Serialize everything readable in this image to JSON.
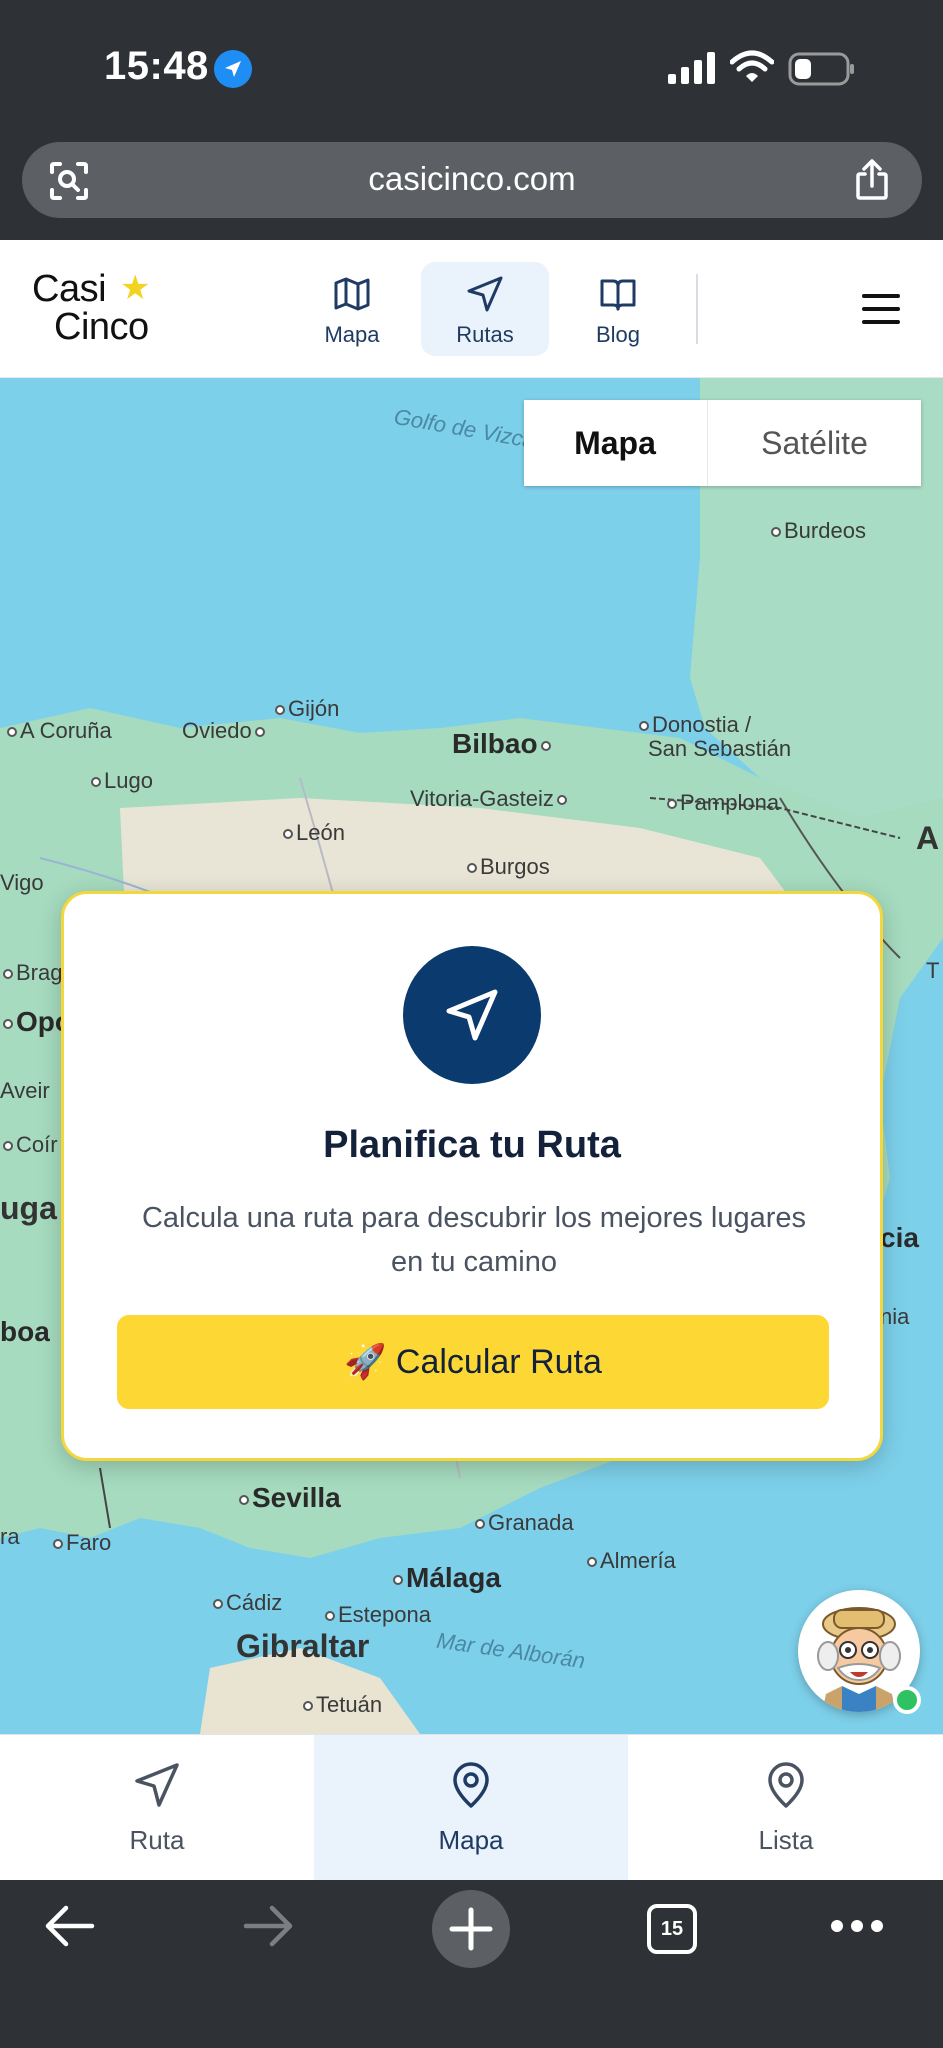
{
  "status_bar": {
    "time": "15:48"
  },
  "browser": {
    "url": "casicinco.com",
    "open_tabs": "15"
  },
  "site_header": {
    "logo_line1": "Casi",
    "logo_line2": "Cinco",
    "nav": [
      {
        "label": "Mapa",
        "icon": "map-icon"
      },
      {
        "label": "Rutas",
        "icon": "navigation-arrow-icon",
        "active": true
      },
      {
        "label": "Blog",
        "icon": "book-icon"
      }
    ]
  },
  "map": {
    "map_type": {
      "map": "Mapa",
      "satellite": "Satélite",
      "selected": "Mapa"
    },
    "labels": {
      "golfo": "Golfo de Vizcaya",
      "burdeos": "Burdeos",
      "acoruna": "A Coruña",
      "oviedo": "Oviedo",
      "gijon": "Gijón",
      "bilbao": "Bilbao",
      "donostia1": "Donostia /",
      "donostia2": "San Sebastián",
      "lugo": "Lugo",
      "vitoria": "Vitoria-Gasteiz",
      "pamplona": "Pamplona",
      "leon": "León",
      "burgos": "Burgos",
      "vigo": "Vigo",
      "braga": "Brag",
      "oporto": "Opor",
      "aveiro": "Aveir",
      "coimbra": "Coír",
      "portugal": "uga",
      "lisboa": "boa",
      "valencia": "cia",
      "valencia2": "nia",
      "sevilla": "Sevilla",
      "granada": "Granada",
      "faro": "Faro",
      "malaga": "Málaga",
      "almeria": "Almería",
      "cadiz": "Cádiz",
      "estepona": "Estepona",
      "gibraltar": "Gibraltar",
      "alboran": "Mar de Alborán",
      "tetuan": "Tetuán",
      "andorra": "A",
      "edge_t": "T",
      "edge_ra": "ra"
    }
  },
  "route_card": {
    "title": "Planifica tu Ruta",
    "description": "Calcula una ruta para descubrir los mejores lugares en tu camino",
    "button_emoji": "🚀",
    "button_label": "Calcular Ruta"
  },
  "bottom_tabs": [
    {
      "label": "Ruta",
      "icon": "navigation-arrow-icon"
    },
    {
      "label": "Mapa",
      "icon": "map-pin-icon",
      "active": true
    },
    {
      "label": "Lista",
      "icon": "map-pin-icon"
    }
  ],
  "colors": {
    "brand_navy": "#0b3a6e",
    "accent_yellow": "#fdd835",
    "active_tab_bg": "#eaf2fb",
    "online_green": "#2ec262"
  }
}
